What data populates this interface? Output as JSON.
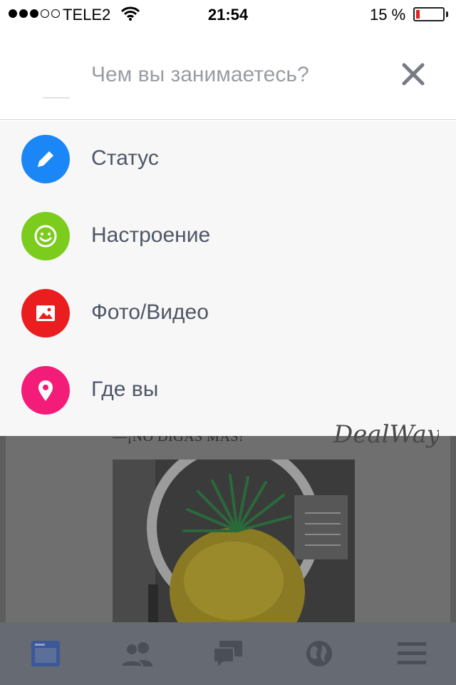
{
  "status_bar": {
    "carrier": "TELE2",
    "time": "21:54",
    "battery_percent": "15 %",
    "battery_level": 0.15,
    "signal_bars_filled": 3,
    "signal_bars_total": 5
  },
  "composer": {
    "placeholder": "Чем вы занимаетесь?"
  },
  "menu": {
    "items": [
      {
        "label": "Статус",
        "icon": "pencil-icon",
        "color": "#1b86f5"
      },
      {
        "label": "Настроение",
        "icon": "smiley-icon",
        "color": "#7ccc1e"
      },
      {
        "label": "Фото/Видео",
        "icon": "photo-icon",
        "color": "#ea1e1e"
      },
      {
        "label": "Где вы",
        "icon": "location-pin-icon",
        "color": "#f41c79"
      }
    ]
  },
  "feed": {
    "caption": "—¡NO DIGAS MAS!"
  },
  "watermark": "DealWay",
  "tabbar": {
    "tabs": [
      {
        "icon": "news-feed-icon",
        "active": true
      },
      {
        "icon": "friends-icon",
        "active": false
      },
      {
        "icon": "messages-icon",
        "active": false
      },
      {
        "icon": "globe-icon",
        "active": false
      },
      {
        "icon": "menu-icon",
        "active": false
      }
    ],
    "active_color": "#3b5998",
    "inactive_color": "#4a4e56"
  }
}
